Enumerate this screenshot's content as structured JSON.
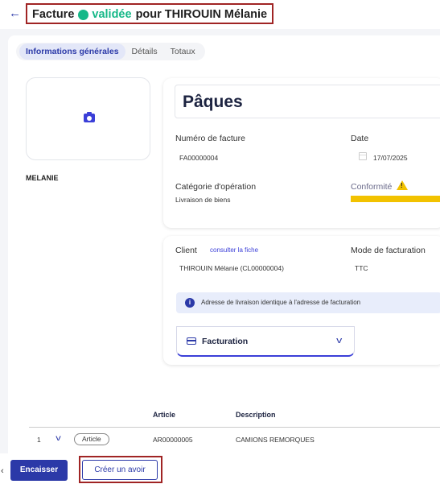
{
  "header": {
    "title_prefix": "Facture",
    "status_text": "validée",
    "title_suffix": "pour THIROUIN Mélanie",
    "status_color": "#16b888"
  },
  "tabs": [
    {
      "label": "Informations générales",
      "active": true
    },
    {
      "label": "Détails",
      "active": false
    },
    {
      "label": "Totaux",
      "active": false
    }
  ],
  "photo": {
    "icon": "camera-icon",
    "name": "MELANIE"
  },
  "document": {
    "title": "Pâques",
    "invoice_number_label": "Numéro de facture",
    "invoice_number": "FA00000004",
    "date_label": "Date",
    "date": "17/07/2025",
    "category_label": "Catégorie d'opération",
    "category": "Livraison de biens",
    "compliance_label": "Conformité",
    "compliance_icon": "warning-icon",
    "compliance_color": "#f2c200"
  },
  "client": {
    "label": "Client",
    "link": "consulter la fiche",
    "value": "THIROUIN Mélanie (CL00000004)",
    "billing_mode_label": "Mode de facturation",
    "billing_mode": "TTC",
    "info_text": "Adresse de livraison identique à l'adresse de facturation",
    "accordion_label": "Facturation"
  },
  "table": {
    "headers": [
      "Article",
      "Description"
    ],
    "rows": [
      {
        "index": "1",
        "type": "Article",
        "article": "AR00000005",
        "description": "CAMIONS REMORQUES"
      }
    ]
  },
  "actions": {
    "encaisser": "Encaisser",
    "creer_avoir": "Créer un avoir"
  },
  "colors": {
    "primary": "#2b39a8",
    "highlight_border": "#a02424"
  }
}
